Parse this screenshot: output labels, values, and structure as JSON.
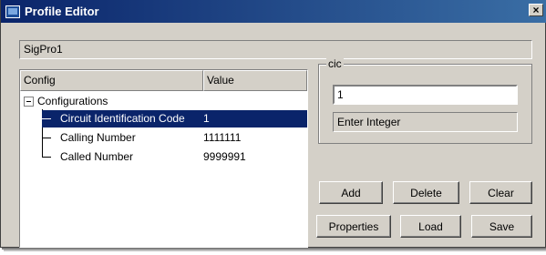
{
  "window": {
    "title": "Profile Editor",
    "close_label": "×"
  },
  "profile_name": "SigPro1",
  "tree": {
    "columns": [
      "Config",
      "Value"
    ],
    "root_label": "Configurations",
    "items": [
      {
        "name": "Circuit Identification Code",
        "value": "1",
        "selected": true
      },
      {
        "name": "Calling Number",
        "value": "1111111",
        "selected": false
      },
      {
        "name": "Called Number",
        "value": "9999991",
        "selected": false
      }
    ]
  },
  "editor": {
    "group_label": "cic",
    "input_value": "1",
    "hint": "Enter Integer"
  },
  "buttons": {
    "add": "Add",
    "delete": "Delete",
    "clear": "Clear",
    "properties": "Properties",
    "load": "Load",
    "save": "Save"
  },
  "colors": {
    "titlebar_start": "#0a246a",
    "titlebar_end": "#3a6ea5",
    "selection": "#0a246a",
    "face": "#d4d0c8"
  }
}
